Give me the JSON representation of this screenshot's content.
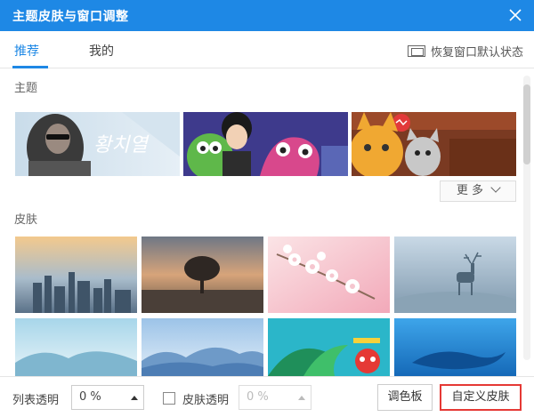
{
  "window": {
    "title": "主题皮肤与窗口调整"
  },
  "tabs": [
    {
      "label": "推荐",
      "active": true
    },
    {
      "label": "我的",
      "active": false
    }
  ],
  "restore": {
    "label": "恢复窗口默认状态"
  },
  "sections": {
    "themes_label": "主题",
    "skins_label": "皮肤"
  },
  "themes": [
    {
      "name": "theme-singer-korean",
      "text": "황치열"
    },
    {
      "name": "theme-cartoon-singer"
    },
    {
      "name": "theme-cartoon-cats"
    }
  ],
  "more": {
    "label": "更 多"
  },
  "skins": [
    "city-skyline",
    "misty-tree",
    "cherry-blossom",
    "deer-in-fog",
    "blue-mountains",
    "mountain-mist",
    "festive-tropical",
    "whale-sea"
  ],
  "bottom": {
    "list_transparency_label": "列表透明",
    "list_transparency_value": "0 %",
    "skin_transparency_label": "皮肤透明",
    "skin_transparency_value": "0 %",
    "palette_button": "调色板",
    "custom_skin_button": "自定义皮肤"
  },
  "colors": {
    "accent": "#1e88e5",
    "highlight_border": "#e53935"
  }
}
